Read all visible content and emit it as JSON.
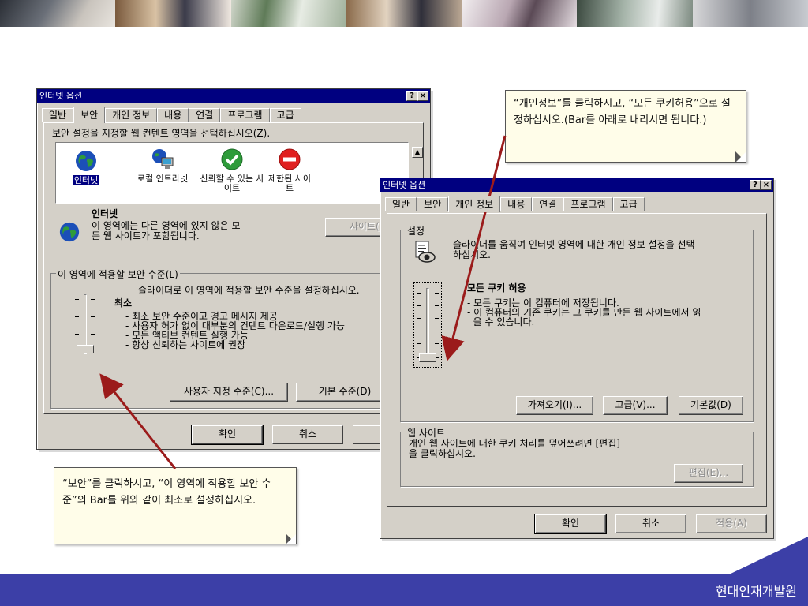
{
  "footer": {
    "brand": "현대인재개발원"
  },
  "callout_top": {
    "text": "“개인정보”를 클릭하시고, “모든 쿠키허용”으로 설정하십시오.(Bar를 아래로 내리시면 됩니다.)"
  },
  "callout_bottom": {
    "text": "“보안”를 클릭하시고, “이 영역에 적용할 보안 수준”의 Bar를 위와 같이 최소로 설정하십시오."
  },
  "win1": {
    "title": "인터넷 옵션",
    "help_btn": "?",
    "close_btn": "×",
    "tabs": [
      {
        "label": "일반"
      },
      {
        "label": "보안"
      },
      {
        "label": "개인 정보"
      },
      {
        "label": "내용"
      },
      {
        "label": "연결"
      },
      {
        "label": "프로그램"
      },
      {
        "label": "고급"
      }
    ],
    "instruction": "보안 설정을 지정할 웹 컨텐트 영역을 선택하십시오(Z).",
    "zones": [
      {
        "label": "인터넷",
        "icon": "globe-icon"
      },
      {
        "label": "로컬 인트라넷",
        "icon": "intranet-icon"
      },
      {
        "label": "신뢰할 수 있는 사이트",
        "icon": "check-icon"
      },
      {
        "label": "제한된 사이트",
        "icon": "restricted-icon"
      }
    ],
    "zone_title": "인터넷",
    "zone_desc_1": "이 영역에는 다른 영역에 있지 않은 모",
    "zone_desc_2": "든 웹 사이트가 포함됩니다.",
    "sites_btn": "사이트(S)",
    "level_group": "이 영역에 적용할 보안 수준(L)",
    "level_hint": "슬라이더로 이 영역에 적용할 보안 수준을 설정하십시오.",
    "level_name": "최소",
    "level_items": [
      "- 최소 보안 수준이고 경고 메시지 제공",
      "- 사용자 허가 없이 대부분의 컨텐트 다운로드/실행 가능",
      "- 모든 액티브 컨텐트 실행 가능",
      "- 항상 신뢰하는 사이트에 권장"
    ],
    "custom_btn": "사용자 지정 수준(C)...",
    "default_btn": "기본 수준(D)",
    "ok_btn": "확인",
    "cancel_btn": "취소",
    "apply_btn": "적"
  },
  "win2": {
    "title": "인터넷 옵션",
    "help_btn": "?",
    "close_btn": "×",
    "tabs": [
      {
        "label": "일반"
      },
      {
        "label": "보안"
      },
      {
        "label": "개인 정보"
      },
      {
        "label": "내용"
      },
      {
        "label": "연결"
      },
      {
        "label": "프로그램"
      },
      {
        "label": "고급"
      }
    ],
    "settings_group": "설정",
    "settings_desc_1": "슬라이더를 움직여 인터넷 영역에 대한 개인 정보 설정을 선택",
    "settings_desc_2": "하십시오.",
    "level_name": "모든 쿠키 허용",
    "level_items": [
      "- 모든 쿠키는 이 컴퓨터에 저장됩니다.",
      "- 이 컴퓨터의 기존 쿠키는 그 쿠키를 만든 웹 사이트에서 읽",
      "  을 수 있습니다."
    ],
    "import_btn": "가져오기(I)...",
    "advanced_btn": "고급(V)...",
    "default_btn": "기본값(D)",
    "web_group": "웹 사이트",
    "web_desc_1": "개인 웹 사이트에 대한 쿠키 처리를 덮어쓰려면 [편집]",
    "web_desc_2": "을 클릭하십시오.",
    "edit_btn": "편집(E)...",
    "ok_btn": "확인",
    "cancel_btn": "취소",
    "apply_btn": "적용(A)"
  }
}
